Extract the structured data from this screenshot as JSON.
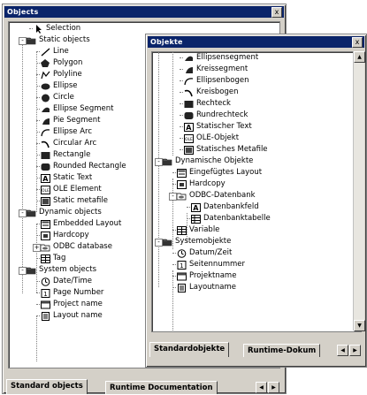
{
  "win1": {
    "title": "Objects",
    "close": "x",
    "tree": [
      {
        "label": "Selection",
        "icon": "pointer-icon"
      },
      {
        "label": "Static objects",
        "icon": "folder-icon"
      },
      {
        "label": "Line",
        "icon": "line-icon"
      },
      {
        "label": "Polygon",
        "icon": "polygon-icon"
      },
      {
        "label": "Polyline",
        "icon": "polyline-icon"
      },
      {
        "label": "Ellipse",
        "icon": "ellipse-icon"
      },
      {
        "label": "Circle",
        "icon": "circle-icon"
      },
      {
        "label": "Ellipse Segment",
        "icon": "ellipse-segment-icon"
      },
      {
        "label": "Pie Segment",
        "icon": "pie-segment-icon"
      },
      {
        "label": "Ellipse Arc",
        "icon": "ellipse-arc-icon"
      },
      {
        "label": "Circular Arc",
        "icon": "circular-arc-icon"
      },
      {
        "label": "Rectangle",
        "icon": "rectangle-icon"
      },
      {
        "label": "Rounded Rectangle",
        "icon": "rounded-rectangle-icon"
      },
      {
        "label": "Static Text",
        "icon": "text-icon"
      },
      {
        "label": "OLE Element",
        "icon": "ole-icon"
      },
      {
        "label": "Static metafile",
        "icon": "metafile-icon"
      },
      {
        "label": "Dynamic objects",
        "icon": "folder-icon"
      },
      {
        "label": "Embedded Layout",
        "icon": "embedded-layout-icon"
      },
      {
        "label": "Hardcopy",
        "icon": "hardcopy-icon"
      },
      {
        "label": "ODBC database",
        "icon": "database-icon"
      },
      {
        "label": "Tag",
        "icon": "tag-icon"
      },
      {
        "label": "System objects",
        "icon": "folder-icon"
      },
      {
        "label": "Date/Time",
        "icon": "clock-icon"
      },
      {
        "label": "Page Number",
        "icon": "page-number-icon"
      },
      {
        "label": "Project name",
        "icon": "project-name-icon"
      },
      {
        "label": "Layout name",
        "icon": "layout-name-icon"
      }
    ],
    "tabs": [
      "Standard objects",
      "Runtime Documentation"
    ]
  },
  "win2": {
    "title": "Objekte",
    "close": "x",
    "tree": [
      {
        "label": "Ellipsensegment",
        "icon": "ellipse-segment-icon"
      },
      {
        "label": "Kreissegment",
        "icon": "pie-segment-icon"
      },
      {
        "label": "Ellipsenbogen",
        "icon": "ellipse-arc-icon"
      },
      {
        "label": "Kreisbogen",
        "icon": "circular-arc-icon"
      },
      {
        "label": "Rechteck",
        "icon": "rectangle-icon"
      },
      {
        "label": "Rundrechteck",
        "icon": "rounded-rectangle-icon"
      },
      {
        "label": "Statischer Text",
        "icon": "text-icon"
      },
      {
        "label": "OLE-Objekt",
        "icon": "ole-icon"
      },
      {
        "label": "Statisches Metafile",
        "icon": "metafile-icon"
      },
      {
        "label": "Dynamische Objekte",
        "icon": "folder-icon"
      },
      {
        "label": "Eingefügtes Layout",
        "icon": "embedded-layout-icon"
      },
      {
        "label": "Hardcopy",
        "icon": "hardcopy-icon"
      },
      {
        "label": "ODBC-Datenbank",
        "icon": "database-icon"
      },
      {
        "label": "Datenbankfeld",
        "icon": "text-icon"
      },
      {
        "label": "Datenbanktabelle",
        "icon": "table-icon"
      },
      {
        "label": "Variable",
        "icon": "tag-icon"
      },
      {
        "label": "Systemobjekte",
        "icon": "folder-icon"
      },
      {
        "label": "Datum/Zeit",
        "icon": "clock-icon"
      },
      {
        "label": "Seitennummer",
        "icon": "page-number-icon"
      },
      {
        "label": "Projektname",
        "icon": "project-name-icon"
      },
      {
        "label": "Layoutname",
        "icon": "layout-name-icon"
      }
    ],
    "tabs": [
      "Standardobjekte",
      "Runtime-Dokum"
    ]
  },
  "colors": {
    "titlebar": "#0a246a",
    "face": "#d4d0c8"
  }
}
